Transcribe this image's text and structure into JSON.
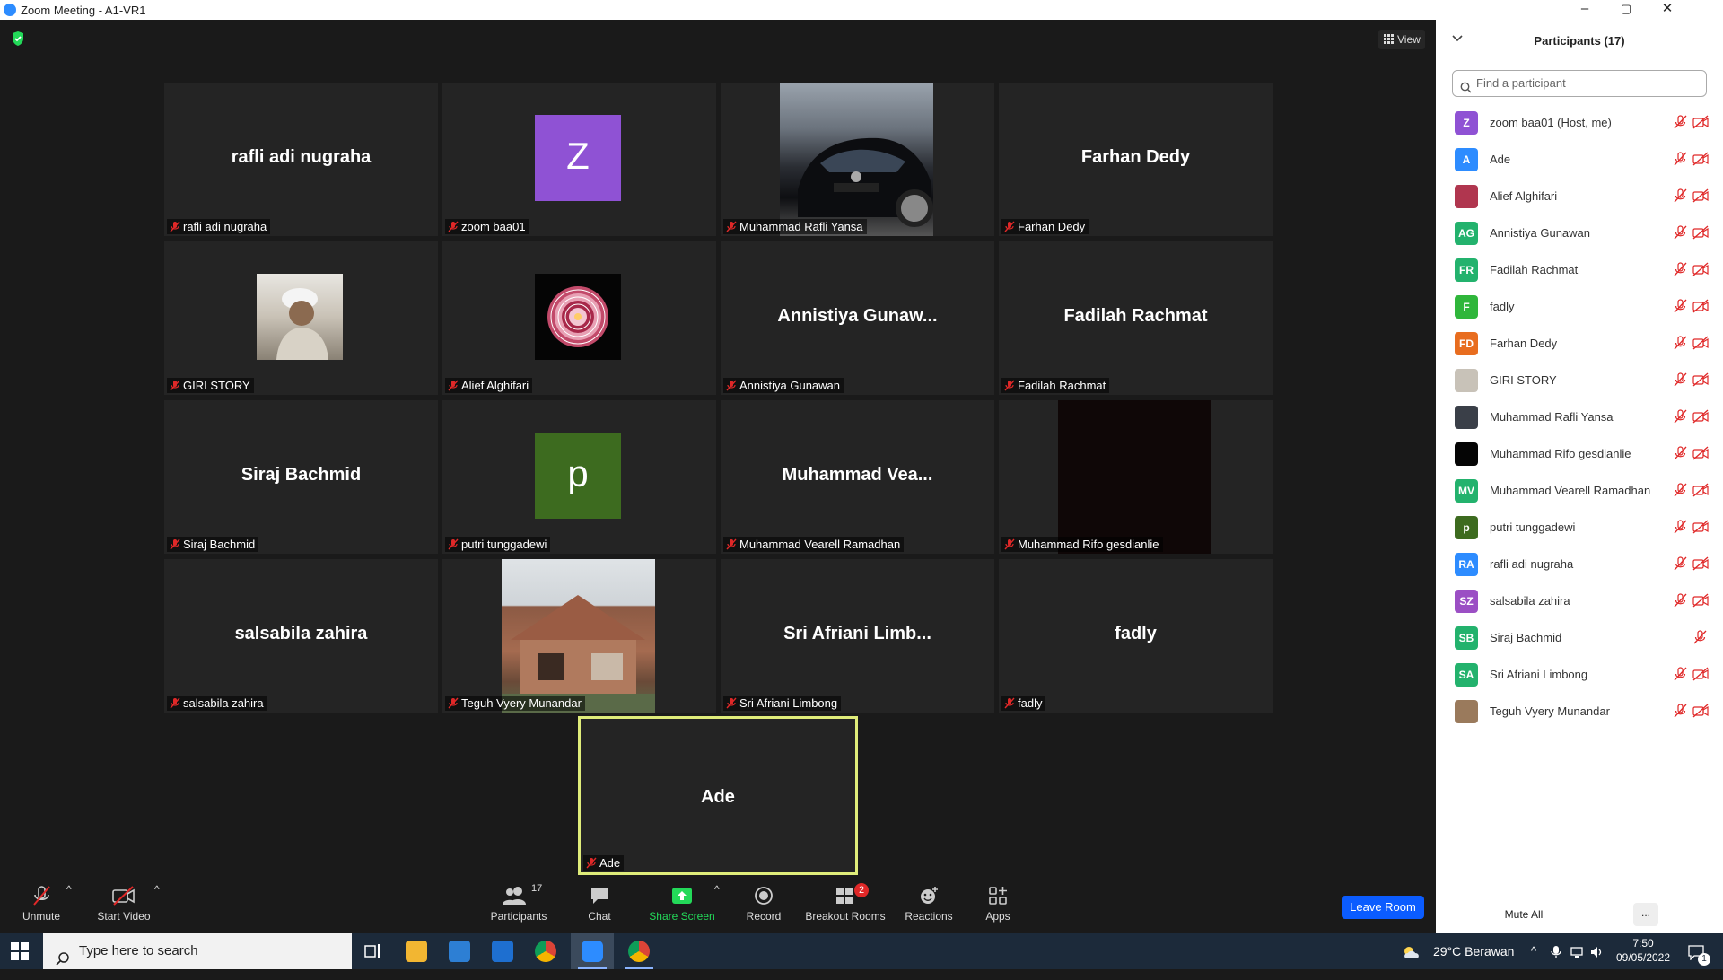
{
  "window": {
    "title": "Zoom Meeting - A1-VR1",
    "controls": [
      "–",
      "▢",
      "✕"
    ]
  },
  "view_button": "View",
  "tiles": [
    {
      "big": "rafli adi nugraha",
      "label": "rafli adi nugraha"
    },
    {
      "avatar": "Z",
      "avatar_color": "#8f52d4",
      "label": "zoom baa01"
    },
    {
      "photo": "car",
      "label": "Muhammad Rafli Yansa"
    },
    {
      "big": "Farhan Dedy",
      "label": "Farhan Dedy"
    },
    {
      "photo": "person",
      "label": "GIRI STORY"
    },
    {
      "photo": "mandala",
      "label": "Alief Alghifari"
    },
    {
      "big": "Annistiya  Gunaw...",
      "label": "Annistiya Gunawan"
    },
    {
      "big": "Fadilah Rachmat",
      "label": "Fadilah Rachmat"
    },
    {
      "big": "Siraj Bachmid",
      "label": "Siraj Bachmid"
    },
    {
      "avatar": "p",
      "avatar_color": "#3d6b1f",
      "label": "putri tunggadewi"
    },
    {
      "big": "Muhammad  Vea...",
      "label": "Muhammad Vearell Ramadhan"
    },
    {
      "photo": "dark",
      "label": "Muhammad Rifo gesdianlie"
    },
    {
      "big": "salsabila zahira",
      "label": "salsabila zahira"
    },
    {
      "photo": "house",
      "label": "Teguh Vyery Munandar"
    },
    {
      "big": "Sri  Afriani  Limb...",
      "label": "Sri Afriani Limbong"
    },
    {
      "big": "fadly",
      "label": "fadly"
    }
  ],
  "active_speaker": {
    "big": "Ade",
    "label": "Ade",
    "border_color": "#dfec7a"
  },
  "toolbar": {
    "unmute": "Unmute",
    "start_video": "Start Video",
    "participants": "Participants",
    "participants_count": "17",
    "chat": "Chat",
    "share_screen": "Share Screen",
    "record": "Record",
    "breakout_rooms": "Breakout Rooms",
    "breakout_badge": "2",
    "reactions": "Reactions",
    "apps": "Apps",
    "leave": "Leave Room"
  },
  "panel": {
    "title": "Participants (17)",
    "search_placeholder": "Find a participant",
    "participants": [
      {
        "initials": "Z",
        "color": "#8f52d4",
        "name": "zoom baa01 (Host, me)",
        "video": true
      },
      {
        "initials": "A",
        "color": "#2d8cff",
        "name": "Ade",
        "video": true
      },
      {
        "initials": "",
        "color": "#b0364f",
        "image": "mandala",
        "name": "Alief Alghifari",
        "video": true
      },
      {
        "initials": "AG",
        "color": "#23b26d",
        "name": "Annistiya Gunawan",
        "video": true
      },
      {
        "initials": "FR",
        "color": "#23b26d",
        "name": "Fadilah Rachmat",
        "video": true
      },
      {
        "initials": "F",
        "color": "#2fb63b",
        "name": "fadly",
        "video": true
      },
      {
        "initials": "FD",
        "color": "#e86d1f",
        "name": "Farhan Dedy",
        "video": true
      },
      {
        "initials": "",
        "color": "#c8c2b8",
        "image": "person",
        "name": "GIRI STORY",
        "video": true
      },
      {
        "initials": "",
        "color": "#3a3f48",
        "image": "car",
        "name": "Muhammad Rafli Yansa",
        "video": true
      },
      {
        "initials": "",
        "color": "#050505",
        "image": "dark",
        "name": "Muhammad Rifo gesdianlie",
        "video": true
      },
      {
        "initials": "MV",
        "color": "#23b26d",
        "name": "Muhammad Vearell Ramadhan",
        "video": true
      },
      {
        "initials": "p",
        "color": "#3d6b1f",
        "name": "putri tunggadewi",
        "video": true
      },
      {
        "initials": "RA",
        "color": "#2d8cff",
        "name": "rafli adi nugraha",
        "video": true
      },
      {
        "initials": "SZ",
        "color": "#9b4fc4",
        "name": "salsabila zahira",
        "video": true
      },
      {
        "initials": "SB",
        "color": "#23b26d",
        "name": "Siraj Bachmid",
        "video": false
      },
      {
        "initials": "SA",
        "color": "#23b26d",
        "name": "Sri Afriani Limbong",
        "video": true
      },
      {
        "initials": "",
        "color": "#9a7a5c",
        "image": "house",
        "name": "Teguh Vyery Munandar",
        "video": true
      }
    ],
    "mute_all": "Mute All",
    "more": "..."
  },
  "taskbar": {
    "search_placeholder": "Type here to search",
    "weather": "29°C  Berawan",
    "time": "7:50",
    "date": "09/05/2022",
    "notification_count": "1"
  },
  "colors": {
    "accent_green": "#23d959",
    "leave_blue": "#0b5cff",
    "muted_red": "#e02828",
    "active_border": "#dfec7a"
  }
}
